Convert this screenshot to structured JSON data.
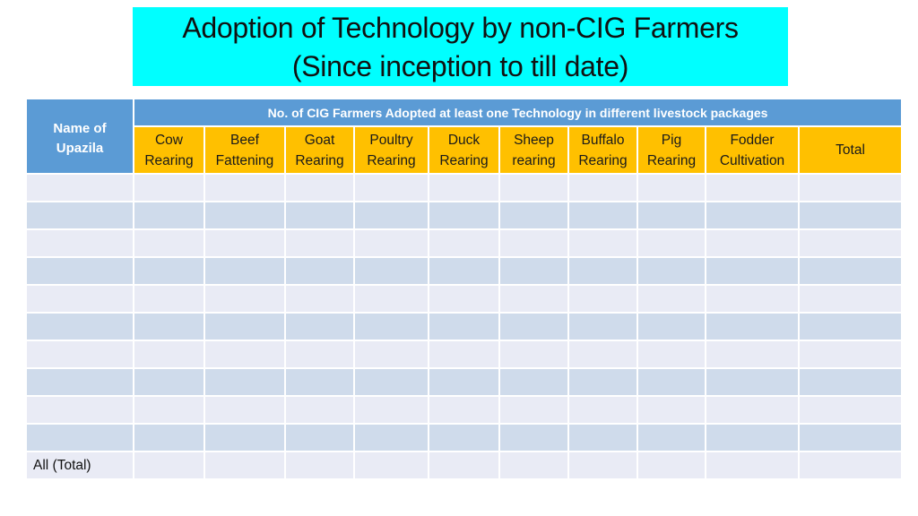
{
  "title": {
    "line1": "Adoption of Technology by non-CIG Farmers",
    "line2": "(Since inception to till date)",
    "background": "#00ffff"
  },
  "table": {
    "upazila_header_line1": "Name of",
    "upazila_header_line2": "Upazila",
    "group_header": "No. of CIG Farmers Adopted at least one  Technology  in different livestock packages",
    "packages": [
      {
        "line1": "Cow",
        "line2": "Rearing"
      },
      {
        "line1": "Beef",
        "line2": "Fattening"
      },
      {
        "line1": "Goat",
        "line2": "Rearing"
      },
      {
        "line1": "Poultry",
        "line2": "Rearing"
      },
      {
        "line1": "Duck",
        "line2": "Rearing"
      },
      {
        "line1": "Sheep",
        "line2": "rearing"
      },
      {
        "line1": "Buffalo",
        "line2": "Rearing"
      },
      {
        "line1": "Pig",
        "line2": "Rearing"
      },
      {
        "line1": "Fodder",
        "line2": "Cultivation"
      }
    ],
    "total_header": "Total",
    "rows": [
      {
        "upazila": "",
        "values": [
          "",
          "",
          "",
          "",
          "",
          "",
          "",
          "",
          "",
          ""
        ]
      },
      {
        "upazila": "",
        "values": [
          "",
          "",
          "",
          "",
          "",
          "",
          "",
          "",
          "",
          ""
        ]
      },
      {
        "upazila": "",
        "values": [
          "",
          "",
          "",
          "",
          "",
          "",
          "",
          "",
          "",
          ""
        ]
      },
      {
        "upazila": "",
        "values": [
          "",
          "",
          "",
          "",
          "",
          "",
          "",
          "",
          "",
          ""
        ]
      },
      {
        "upazila": "",
        "values": [
          "",
          "",
          "",
          "",
          "",
          "",
          "",
          "",
          "",
          ""
        ]
      },
      {
        "upazila": "",
        "values": [
          "",
          "",
          "",
          "",
          "",
          "",
          "",
          "",
          "",
          ""
        ]
      },
      {
        "upazila": "",
        "values": [
          "",
          "",
          "",
          "",
          "",
          "",
          "",
          "",
          "",
          ""
        ]
      },
      {
        "upazila": "",
        "values": [
          "",
          "",
          "",
          "",
          "",
          "",
          "",
          "",
          "",
          ""
        ]
      },
      {
        "upazila": "",
        "values": [
          "",
          "",
          "",
          "",
          "",
          "",
          "",
          "",
          "",
          ""
        ]
      },
      {
        "upazila": "",
        "values": [
          "",
          "",
          "",
          "",
          "",
          "",
          "",
          "",
          "",
          ""
        ]
      }
    ],
    "total_row_label": "All (Total)",
    "colors": {
      "header_blue": "#5b9bd5",
      "header_yellow": "#ffc000",
      "row_light": "#e9ebf5",
      "row_dark": "#cfdbeb"
    }
  }
}
